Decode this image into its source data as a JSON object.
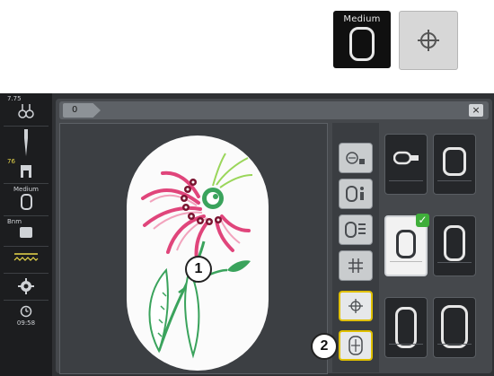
{
  "top_icons": {
    "medium_label": "Medium"
  },
  "left_bar": {
    "top_value": "7.75",
    "needle_value": "76",
    "hoop_label": "Medium",
    "frame_label": "Bnm",
    "time": "09:58"
  },
  "title_tab": "0",
  "close_label": "×",
  "callouts": {
    "one": "1",
    "two": "2"
  },
  "colors": {
    "accent_yellow": "#e0c000",
    "check_green": "#3fae3a",
    "screen_dark": "#2f3134"
  }
}
